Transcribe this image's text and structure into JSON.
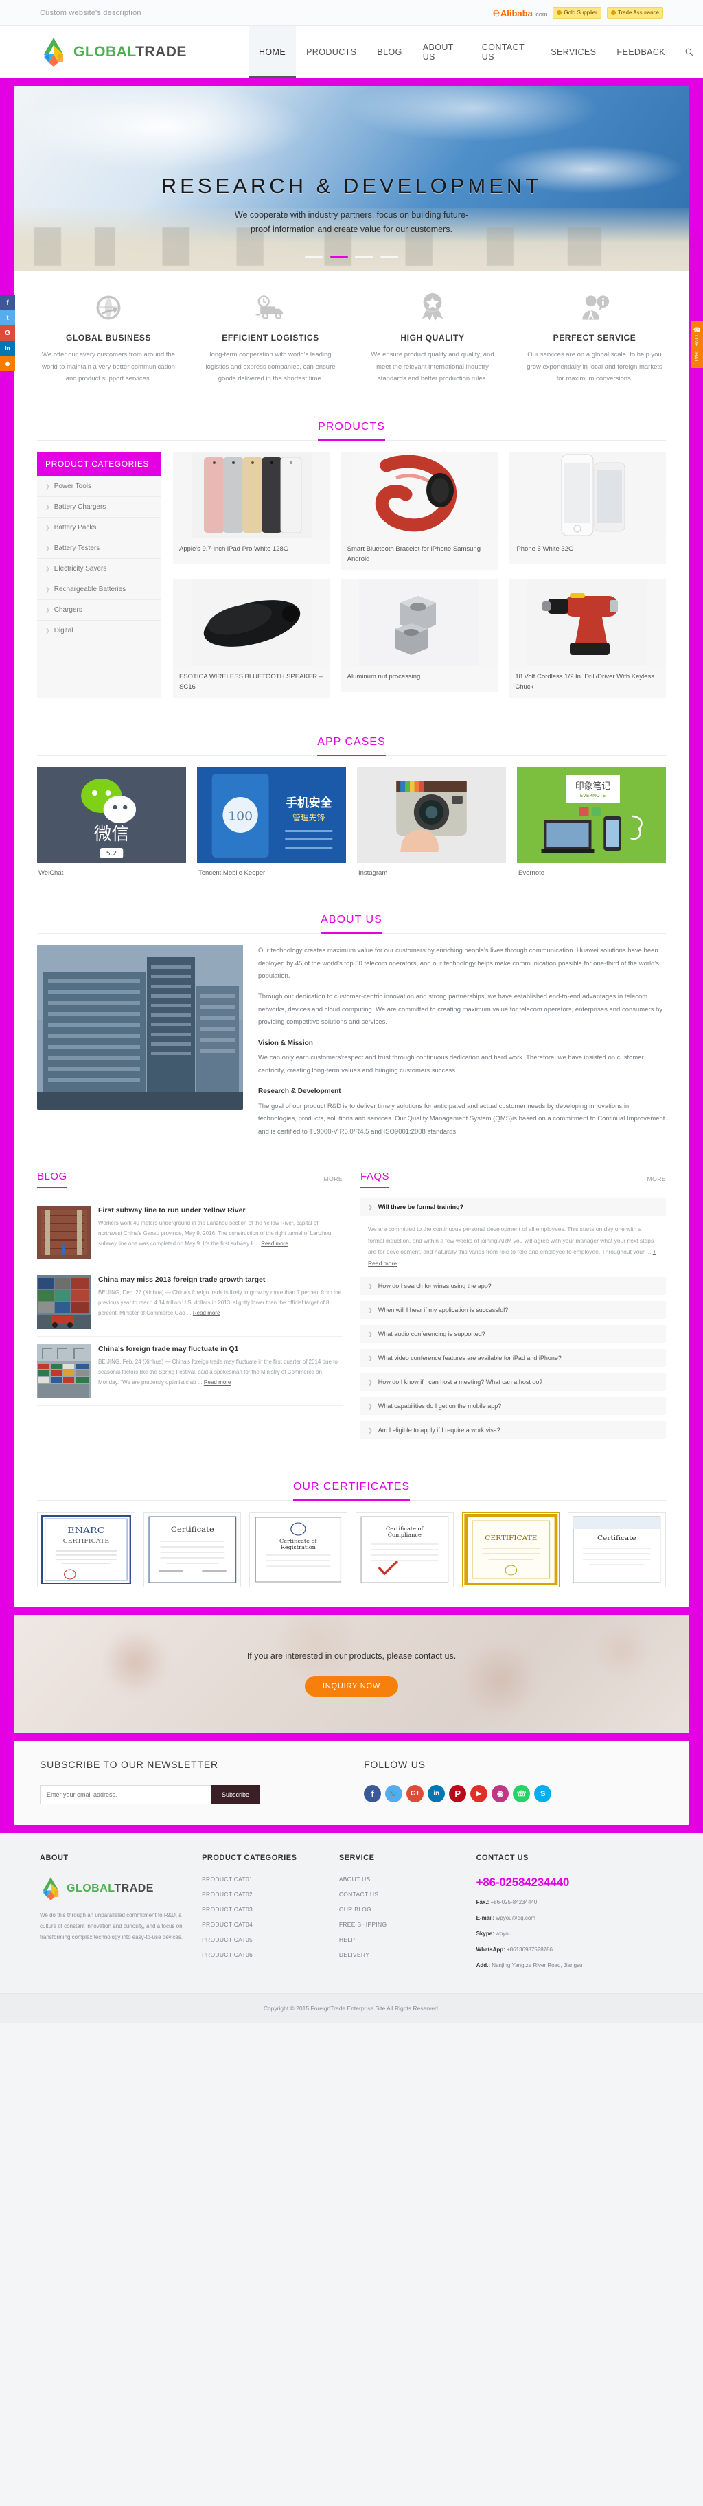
{
  "topbar": {
    "description": "Custom website's description",
    "alibaba_mark": "Alibaba",
    "alibaba_word": "Alibaba",
    "alibaba_com": ".com",
    "gold_supplier": "Gold Supplier",
    "trade_assurance": "Trade Assurance"
  },
  "header": {
    "logo_part1": "GLOBAL",
    "logo_part2": "TRADE",
    "nav": [
      {
        "label": "HOME",
        "active": true
      },
      {
        "label": "PRODUCTS",
        "active": false
      },
      {
        "label": "BLOG",
        "active": false
      },
      {
        "label": "ABOUT US",
        "active": false
      },
      {
        "label": "CONTACT US",
        "active": false
      },
      {
        "label": "SERVICES",
        "active": false
      },
      {
        "label": "FEEDBACK",
        "active": false
      }
    ],
    "search_icon": "search-icon"
  },
  "hero": {
    "title": "RESEARCH  &  DEVELOPMENT",
    "subtitle_line1": "We cooperate with industry partners, focus on building future-",
    "subtitle_line2": "proof information and create value for our customers."
  },
  "live_chat": {
    "label": "LIVE CHAT"
  },
  "social_rail": [
    {
      "name": "facebook-icon",
      "glyph": "f",
      "color": "#3b5998"
    },
    {
      "name": "twitter-icon",
      "glyph": "t",
      "color": "#55acee"
    },
    {
      "name": "googleplus-icon",
      "glyph": "G",
      "color": "#dd4b39"
    },
    {
      "name": "linkedin-icon",
      "glyph": "in",
      "color": "#0077b5"
    },
    {
      "name": "rss-icon",
      "glyph": "•",
      "color": "#f57c00"
    }
  ],
  "features": [
    {
      "icon": "globe-arrow-icon",
      "title": "GLOBAL BUSINESS",
      "text": "We offer our every customers from around the world to maintain a very better communication and product support services."
    },
    {
      "icon": "delivery-truck-icon",
      "title": "EFFICIENT LOGISTICS",
      "text": "long-term cooperation with world's leading logistics and express companies, can ensure goods delivered in the shortest time."
    },
    {
      "icon": "quality-medal-icon",
      "title": "HIGH QUALITY",
      "text": "We ensure product quality and quality, and meet the relevant international industry standards and better production rules."
    },
    {
      "icon": "support-agent-icon",
      "title": "PERFECT SERVICE",
      "text": "Our services are on a global scale, to help you grow exponentially in local and foreign markets for maximum conversions."
    }
  ],
  "products": {
    "section_title": "PRODUCTS",
    "categories_header": "PRODUCT CATEGORIES",
    "categories": [
      "Power Tools",
      "Battery Chargers",
      "Battery Packs",
      "Battery Testers",
      "Electricity Savers",
      "Rechargeable Batteries",
      "Chargers",
      "Digital"
    ],
    "items": [
      {
        "name": "Apple's 9.7-inch iPad Pro White 128G",
        "image": "ipad-pro-colors"
      },
      {
        "name": "Smart Bluetooth Bracelet for iPhone Samsung Android",
        "image": "red-bluetooth-bracelet"
      },
      {
        "name": "iPhone 6 White 32G",
        "image": "white-iphone-6"
      },
      {
        "name": "ESOTICA WIRELESS BLUETOOTH SPEAKER – SC16",
        "image": "black-bluetooth-speaker"
      },
      {
        "name": "Aluminum nut processing",
        "image": "aluminum-nuts"
      },
      {
        "name": "18 Volt Cordless 1/2 In. Drill/Driver With Keyless Chuck",
        "image": "cordless-drill"
      }
    ]
  },
  "app_cases": {
    "section_title": "APP CASES",
    "items": [
      {
        "name": "WeiChat",
        "image": "wechat-splash",
        "caption": "微信",
        "version": "5.2"
      },
      {
        "name": "Tencent Mobile Keeper",
        "image": "tencent-mobile-keeper",
        "caption": "手机安全管理先锋",
        "version": "100"
      },
      {
        "name": "Instagram",
        "image": "instagram-camera",
        "caption": "",
        "version": ""
      },
      {
        "name": "Evernote",
        "image": "evernote-devices",
        "caption": "印象笔记",
        "version": "EVERNOTE"
      }
    ]
  },
  "about": {
    "section_title": "ABOUT US",
    "image": "office-building-photo",
    "paragraphs": [
      "Our technology creates maximum value for our customers by enriching people's lives through communication. Huawei solutions have been deployed by 45 of the world's top 50 telecom operators, and our technology helps make communication possible for one-third of the world's population.",
      "Through our dedication to customer-centric innovation and strong partnerships, we have established end-to-end advantages in telecom networks, devices and cloud computing. We are committed to creating maximum value for telecom operators, enterprises and consumers by providing competitive solutions and services."
    ],
    "blocks": [
      {
        "heading": "Vision & Mission",
        "text": "We can only earn customers'respect and trust through continuous dedication and hard work. Therefore, we have insisted on customer centricity, creating long-term values and bringing customers success."
      },
      {
        "heading": "Research & Development",
        "text": "The goal of our product R&D is to deliver timely solutions for anticipated and actual customer needs by developing innovations in technologies, products, solutions and services. Our Quality Management System (QMS)is based on a commitment to Continual Improvement and is certified to TL9000-V R5.0/R4.5 and ISO9001:2008 standards."
      }
    ]
  },
  "blog": {
    "heading": "BLOG",
    "more": "MORE",
    "read_more": "Read more",
    "items": [
      {
        "title": "First subway line to run under Yellow River",
        "excerpt": "Workers work 40 meters underground in the Lanzhou section of the Yellow River, capital of northwest China's Gansu province, May 9, 2016. The construction of the right tunnel of Lanzhou subway line one was completed on May 9. It's the first subway li ...",
        "image": "subway-tunnel-photo"
      },
      {
        "title": "China may miss 2013 foreign trade growth target",
        "excerpt": "BEIJING, Dec. 27 (Xinhua) — China's foreign trade is likely to grow by more than 7 percent from the previous year to reach 4.14 trillion U.S. dollars in 2013, slightly lower than the official target of 8 percent. Minister of Commerce Gao ...",
        "image": "shipping-containers-photo"
      },
      {
        "title": "China's foreign trade may fluctuate in Q1",
        "excerpt": "BEIJING, Feb. 24 (Xinhua) — China's foreign trade may fluctuate in the first quarter of 2014 due to seasonal factors like the Spring Festival, said a spokesman for the Ministry of Commerce on Monday. \"We are prudently optimistic ab ...",
        "image": "container-port-photo"
      }
    ]
  },
  "faqs": {
    "heading": "FAQS",
    "more": "MORE",
    "read_more": "+ Read more",
    "open_question": "Will there be formal training?",
    "open_answer": "We are committed to the continuous personal development of all employees. This starts on day one with a formal induction, and within a few weeks of joining ARM you will agree with your manager what your next steps are for development, and naturally this varies from role to role and employee to employee. Throughout your ...",
    "items": [
      "How do I search for wines using the app?",
      "When will I hear if my application is successful?",
      "What audio conferencing is supported?",
      "What video conference features are available for iPad and iPhone?",
      "How do I know if I can host a meeting? What can a host do?",
      "What capabilities do I get on the mobile app?",
      "Am I eligible to apply if I require a work visa?"
    ]
  },
  "certificates": {
    "section_title": "OUR CERTIFICATES",
    "items": [
      {
        "label": "ENARC CERTIFICATE"
      },
      {
        "label": "Certificate"
      },
      {
        "label": "Certificate of Registration"
      },
      {
        "label": "Certificate of Compliance"
      },
      {
        "label": "CERTIFICATE"
      },
      {
        "label": "Certificate"
      }
    ]
  },
  "inquiry": {
    "text": "If you are interested in our products, please contact us.",
    "button": "INQUIRY NOW"
  },
  "subscribe": {
    "heading": "SUBSCRIBE TO OUR NEWSLETTER",
    "placeholder": "Enter your email address.",
    "value": "",
    "button": "Subscribe",
    "follow_heading": "FOLLOW US",
    "socials": [
      {
        "name": "facebook-icon",
        "glyph": "f",
        "color": "#3b5998"
      },
      {
        "name": "twitter-icon",
        "glyph": "ᴛ",
        "color": "#55acee"
      },
      {
        "name": "googleplus-icon",
        "glyph": "G+",
        "color": "#dd4b39"
      },
      {
        "name": "linkedin-icon",
        "glyph": "in",
        "color": "#0077b5"
      },
      {
        "name": "pinterest-icon",
        "glyph": "P",
        "color": "#bd081c"
      },
      {
        "name": "youtube-icon",
        "glyph": "▶",
        "color": "#e52d27"
      },
      {
        "name": "instagram-icon",
        "glyph": "◎",
        "color": "#c13584"
      },
      {
        "name": "whatsapp-icon",
        "glyph": "✆",
        "color": "#25d366"
      },
      {
        "name": "skype-icon",
        "glyph": "S",
        "color": "#00aff0"
      }
    ]
  },
  "footer": {
    "about_heading": "ABOUT",
    "about_logo_part1": "GLOBAL",
    "about_logo_part2": "TRADE",
    "about_text": "We do this through an unparalleled commitment to R&D, a culture of constant innovation and curiosity, and a focus on transforming complex technology into easy-to-use devices.",
    "categories_heading": "PRODUCT CATEGORIES",
    "categories": [
      "PRODUCT CAT01",
      "PRODUCT CAT02",
      "PRODUCT CAT03",
      "PRODUCT CAT04",
      "PRODUCT CAT05",
      "PRODUCT CAT06"
    ],
    "service_heading": "SERVICE",
    "service": [
      "ABOUT US",
      "CONTACT US",
      "OUR BLOG",
      "FREE SHIPPING",
      "HELP",
      "DELIVERY"
    ],
    "contact_heading": "CONTACT US",
    "phone": "+86-02584234440",
    "fax_label": "Fax.:",
    "fax": "+86-025-84234440",
    "email_label": "E-mail:",
    "email": "wpyou@qq.com",
    "skype_label": "Skype:",
    "skype": "wpyou",
    "whatsapp_label": "WhatsApp:",
    "whatsapp": "+86136987528786",
    "address_label": "Add.:",
    "address": "Nanjing Yangtze River Road, Jiangsu",
    "copyright": "Copyright © 2015 ForeignTrade Enterprise Site All Rights Reserved."
  },
  "colors": {
    "accent_magenta": "#e300e3",
    "orange": "#f77f0c",
    "logo_green": "#4caf50",
    "logo_dark": "#4d4d4d"
  }
}
